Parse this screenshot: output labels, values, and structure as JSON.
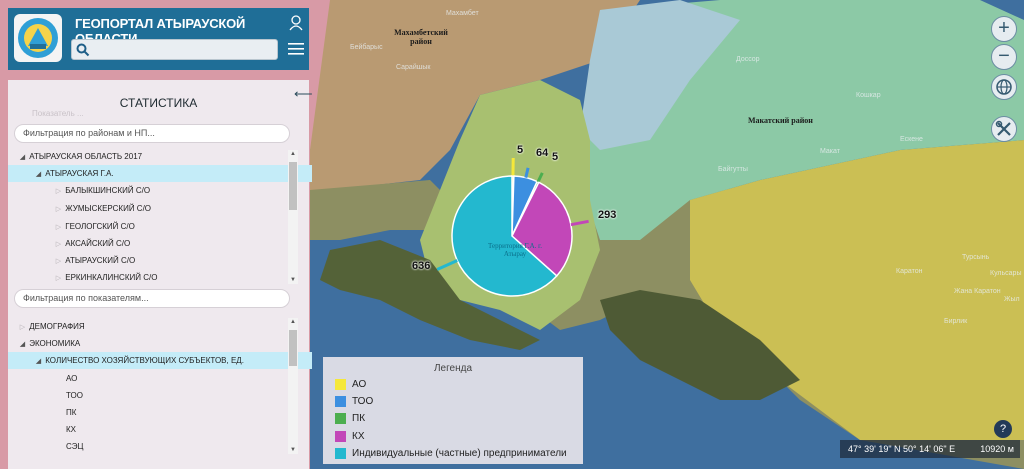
{
  "header": {
    "title": "ГЕОПОРТАЛ АТЫРАУСКОЙ ОБЛАСТИ",
    "search_placeholder": ""
  },
  "panel": {
    "title": "СТАТИСТИКА",
    "faint_text": "Показатель ...",
    "region_filter_placeholder": "Фильтрация по районам и НП...",
    "indicator_filter_placeholder": "Фильтрация по показателям...",
    "region_tree": [
      {
        "label": "АТЫРАУСКАЯ ОБЛАСТЬ 2017",
        "level": 0,
        "expanded": true,
        "selected": false
      },
      {
        "label": "АТЫРАУСКАЯ Г.А.",
        "level": 1,
        "expanded": true,
        "selected": true
      },
      {
        "label": "БАЛЫКШИНСКИЙ С/О",
        "level": 2,
        "expanded": false,
        "selected": false
      },
      {
        "label": "ЖУМЫСКЕРСКИЙ С/О",
        "level": 2,
        "expanded": false,
        "selected": false
      },
      {
        "label": "ГЕОЛОГСКИЙ С/О",
        "level": 2,
        "expanded": false,
        "selected": false
      },
      {
        "label": "АКСАЙСКИЙ С/О",
        "level": 2,
        "expanded": false,
        "selected": false
      },
      {
        "label": "АТЫРАУСКИЙ С/О",
        "level": 2,
        "expanded": false,
        "selected": false
      },
      {
        "label": "ЕРКИНКАЛИНСКИЙ С/О",
        "level": 2,
        "expanded": false,
        "selected": false
      }
    ],
    "indicator_tree": [
      {
        "label": "ДЕМОГРАФИЯ",
        "level": 0,
        "expanded": false,
        "selected": false
      },
      {
        "label": "ЭКОНОМИКА",
        "level": 0,
        "expanded": true,
        "selected": false
      },
      {
        "label": "КОЛИЧЕСТВО ХОЗЯЙСТВУЮЩИХ СУБЪЕКТОВ, ЕД.",
        "level": 1,
        "expanded": true,
        "selected": true
      },
      {
        "label": "АО",
        "level": 2,
        "leaf": true
      },
      {
        "label": "ТОО",
        "level": 2,
        "leaf": true
      },
      {
        "label": "ПК",
        "level": 2,
        "leaf": true
      },
      {
        "label": "КХ",
        "level": 2,
        "leaf": true
      },
      {
        "label": "СЭЦ",
        "level": 2,
        "leaf": true
      }
    ]
  },
  "legend": {
    "title": "Легенда",
    "items": [
      {
        "label": "АО",
        "color": "#f5e83a"
      },
      {
        "label": "ТОО",
        "color": "#3c8fe0"
      },
      {
        "label": "ПК",
        "color": "#4cae4f"
      },
      {
        "label": "КХ",
        "color": "#c247b8"
      },
      {
        "label": "Индивидуальные (частные) предприниматели",
        "color": "#23b8cf"
      }
    ]
  },
  "map": {
    "labels": [
      "Махамбетский район",
      "Макатский район"
    ],
    "minor_labels": [
      "Махамбет",
      "Бейбарыс",
      "Сарайшык",
      "Доссор",
      "Кошкар",
      "Байгутты",
      "Макат",
      "Ескене",
      "Жана Каратон",
      "Турсынь",
      "Каратон",
      "Кульсары",
      "Жыл",
      "Бирлик"
    ],
    "pie_center_label": "Территория Г.А. г. Атырау",
    "zoom_in": "+",
    "zoom_out": "−",
    "coordinates": "47° 39' 19\" N 50° 14' 06\" E",
    "scale": "10920 м",
    "help": "?"
  },
  "chart_data": {
    "type": "pie",
    "title": "",
    "series": [
      {
        "name": "АО",
        "value": 5,
        "color": "#f5e83a"
      },
      {
        "name": "ТОО",
        "value": 64,
        "color": "#3c8fe0"
      },
      {
        "name": "ПК",
        "value": 5,
        "color": "#4cae4f"
      },
      {
        "name": "КХ",
        "value": 293,
        "color": "#c247b8"
      },
      {
        "name": "Индивидуальные (частные) предприниматели",
        "value": 636,
        "color": "#23b8cf"
      }
    ],
    "data_labels": [
      "5",
      "64",
      "5",
      "293",
      "636"
    ]
  }
}
